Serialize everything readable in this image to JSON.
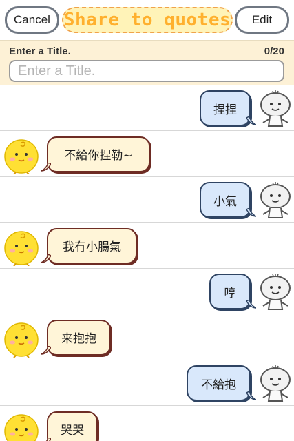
{
  "header": {
    "cancel_label": "Cancel",
    "title": "Share to quotes",
    "edit_label": "Edit"
  },
  "title_entry": {
    "label": "Enter a Title.",
    "counter": "0/20",
    "placeholder": "Enter a Title.",
    "value": ""
  },
  "messages": [
    {
      "sender": "user",
      "text": "捏捏"
    },
    {
      "sender": "bot",
      "text": "不給你捏勒~"
    },
    {
      "sender": "user",
      "text": "小氣"
    },
    {
      "sender": "bot",
      "text": "我冇小腸氣"
    },
    {
      "sender": "user",
      "text": "哼"
    },
    {
      "sender": "bot",
      "text": "来抱抱"
    },
    {
      "sender": "user",
      "text": "不給抱"
    },
    {
      "sender": "bot",
      "text": "哭哭"
    }
  ],
  "colors": {
    "title_text": "#ffb02e",
    "title_pill_bg": "#fff3b8",
    "title_area_bg": "#fdf1d6",
    "user_bubble_bg": "#d9e8fb",
    "bot_bubble_bg": "#fff5d8",
    "bot_avatar": "#ffe034"
  },
  "icons": {
    "user_avatar": "white-doll-avatar-icon",
    "bot_avatar": "yellow-chick-avatar-icon"
  }
}
